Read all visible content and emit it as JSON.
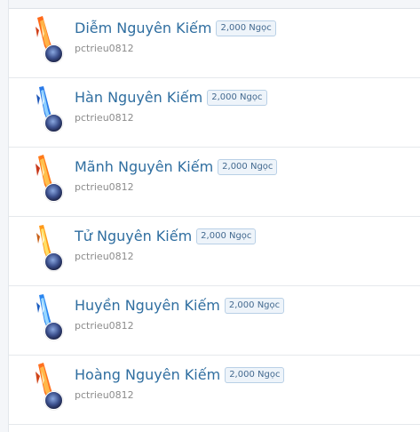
{
  "items": [
    {
      "title": "Diễm Nguyên Kiếm",
      "price": "2,000 Ngọc",
      "author": "pctrieu0812",
      "icon": "flame-sword-icon",
      "colors": [
        "#ff6a1a",
        "#ffb347",
        "#d0401a"
      ]
    },
    {
      "title": "Hàn Nguyên Kiếm",
      "price": "2,000 Ngọc",
      "author": "pctrieu0812",
      "icon": "ice-sword-icon",
      "colors": [
        "#2a7ae8",
        "#8fd0ff",
        "#1d55b8"
      ]
    },
    {
      "title": "Mãnh Nguyên Kiếm",
      "price": "2,000 Ngọc",
      "author": "pctrieu0812",
      "icon": "flame-sword-icon",
      "colors": [
        "#ff7a1a",
        "#ffc04d",
        "#c8381a"
      ]
    },
    {
      "title": "Tử Nguyên Kiếm",
      "price": "2,000 Ngọc",
      "author": "pctrieu0812",
      "icon": "gold-sword-icon",
      "colors": [
        "#ff9a1a",
        "#ffe066",
        "#c86018"
      ]
    },
    {
      "title": "Huyền Nguyên Kiếm",
      "price": "2,000 Ngọc",
      "author": "pctrieu0812",
      "icon": "ice-sword-icon",
      "colors": [
        "#2a86f0",
        "#9ad8ff",
        "#1a5cc0"
      ]
    },
    {
      "title": "Hoàng Nguyên Kiếm",
      "price": "2,000 Ngọc",
      "author": "pctrieu0812",
      "icon": "flame-sword-icon",
      "colors": [
        "#ff7020",
        "#ffb84a",
        "#d04418"
      ]
    }
  ]
}
